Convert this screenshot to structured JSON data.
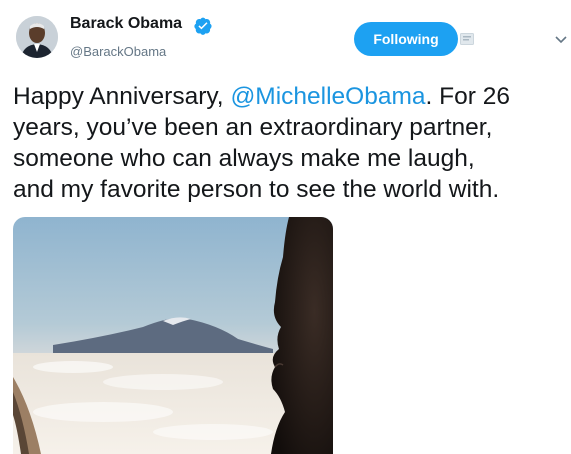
{
  "user": {
    "name": "Barack Obama",
    "handle": "@BarackObama",
    "verified_icon": "verified-badge-icon",
    "avatar_icon": "profile-photo"
  },
  "follow": {
    "label": "Following",
    "color": "#1da1f2"
  },
  "tweet": {
    "lines": [
      {
        "before": "Happy Anniversary, ",
        "mention": "@MichelleObama",
        "after": ". For 26"
      },
      {
        "text": "years, you’ve been an extraordinary partner,"
      },
      {
        "text": "someone who can always make me laugh,"
      },
      {
        "text": "and my favorite person to see the world with."
      }
    ],
    "mention_color": "#1b95e0"
  },
  "media": {
    "description_icon": "attached-photo"
  }
}
